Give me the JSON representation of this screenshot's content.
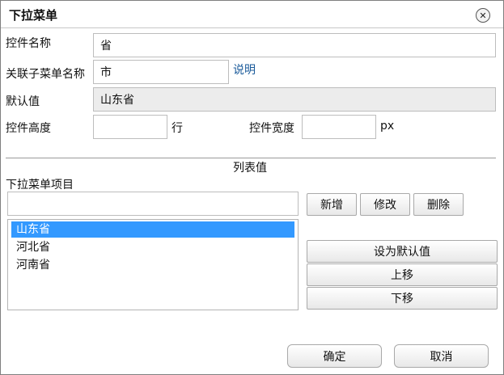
{
  "dialog": {
    "title": "下拉菜单",
    "close_icon": "close-icon"
  },
  "form": {
    "control_name_label": "控件名称",
    "control_name_value": "省",
    "linked_submenu_label": "关联子菜单名称",
    "linked_submenu_value": "市",
    "help_link": "说明",
    "default_value_label": "默认值",
    "default_value_value": "山东省",
    "height_label": "控件高度",
    "height_value": "",
    "height_unit": "行",
    "width_label": "控件宽度",
    "width_value": "",
    "width_unit": "px"
  },
  "list_section": {
    "heading": "列表值",
    "items_label": "下拉菜单项目",
    "item_input_value": "",
    "add_button": "新增",
    "edit_button": "修改",
    "delete_button": "删除",
    "items": [
      "山东省",
      "河北省",
      "河南省"
    ],
    "selected_index": 0,
    "set_default_button": "设为默认值",
    "move_up_button": "上移",
    "move_down_button": "下移"
  },
  "footer": {
    "ok_button": "确定",
    "cancel_button": "取消"
  },
  "colors": {
    "selection": "#3399ff",
    "link": "#1a5a9a",
    "readonly_bg": "#ececec"
  }
}
